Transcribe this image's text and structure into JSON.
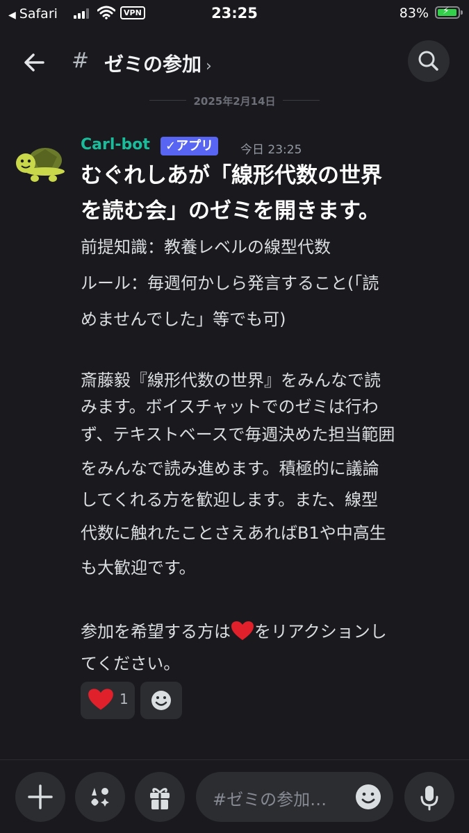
{
  "status_bar": {
    "back_app": "Safari",
    "vpn": "VPN",
    "time": "23:25",
    "battery": "83%",
    "battery_level": 0.83
  },
  "header": {
    "channel_name": "ゼミの参加",
    "chevron": "›"
  },
  "date_separator": "2025年2月14日",
  "message": {
    "author": "Carl-bot",
    "badge": "✓アプリ",
    "timestamp": "今日 23:25",
    "title_lines": [
      "むぐれしあが「線形代数の世界",
      "を読む会」のゼミを開きます。"
    ],
    "body_lines": [
      "前提知識：教養レベルの線型代数",
      "ルール：毎週何かしら発言すること(「読",
      "めませんでした」等でも可)",
      "斎藤毅『線形代数の世界』をみんなで読",
      "みます。ボイスチャットでのゼミは行わ",
      "ず、テキストベースで毎週決めた担当範囲",
      "をみんなで読み進めます。積極的に議論",
      "してくれる方を歓迎します。また、線型",
      "代数に触れたことさえあればB1や中高生",
      "も大歓迎です。",
      "参加を希望する方は",
      "をリアクションし",
      "てください。"
    ]
  },
  "reactions": {
    "heart_count": "1"
  },
  "composer": {
    "placeholder": "#ゼミの参加…"
  },
  "icons": {
    "back": "arrow-left-icon",
    "search": "search-icon",
    "add": "plus-icon",
    "apps": "apps-icon",
    "gift": "gift-icon",
    "emoji": "smiley-icon",
    "mic": "microphone-icon"
  },
  "colors": {
    "background": "#1a1a1e",
    "author": "#1abc9c",
    "badge": "#5865f2",
    "heart": "#e0202b"
  }
}
